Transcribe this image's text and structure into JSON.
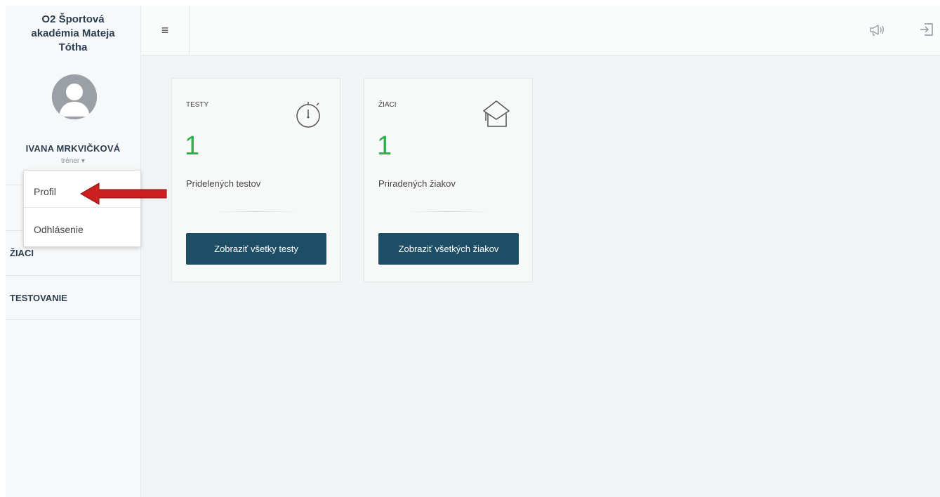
{
  "sidebar": {
    "brand_line1": "O2 Športová",
    "brand_line2": "akadémia Mateja",
    "brand_line3": "Tótha",
    "user_name": "IVANA MRKVIČKOVÁ",
    "user_role": "tréner ▾",
    "nav": [
      {
        "label": "ŽIACI"
      },
      {
        "label": "TESTOVANIE"
      }
    ]
  },
  "dropdown": {
    "items": [
      {
        "label": "Profil"
      },
      {
        "label": "Odhlásenie"
      }
    ]
  },
  "topbar": {
    "menu_icon": "≡",
    "icons": [
      "megaphone-icon",
      "logout-icon"
    ]
  },
  "cards": [
    {
      "title": "TESTY",
      "count": "1",
      "description": "Pridelených testov",
      "button": "Zobraziť všetky testy",
      "icon": "stopwatch-icon"
    },
    {
      "title": "ŽIACI",
      "count": "1",
      "description": "Priradených žiakov",
      "button": "Zobraziť všetkých žiakov",
      "icon": "graduation-cap-icon"
    }
  ],
  "colors": {
    "accent_green": "#27b24a",
    "button_bg": "#1e4e66",
    "arrow_red": "#cc1f1f"
  }
}
